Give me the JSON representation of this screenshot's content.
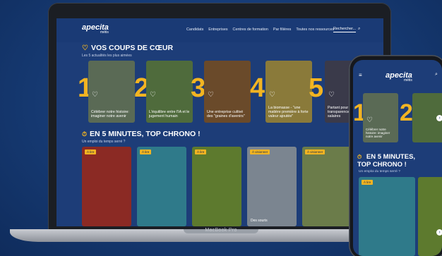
{
  "device_label": "MacBook Pro",
  "site": {
    "logo": "apecita",
    "logo_sub": "métis",
    "nav": [
      "Candidats",
      "Entreprises",
      "Centres de formation",
      "Par filières",
      "Toutes nos ressources"
    ],
    "search_label": "Rechercher..."
  },
  "favorites": {
    "title": "VOS COUPS DE CŒUR",
    "subtitle": "Les 5 actualités les plus aimées",
    "cards": [
      {
        "rank": "1",
        "text": "Célébrer notre histoire: imaginer notre avenir",
        "color": "#5a6a55"
      },
      {
        "rank": "2",
        "text": "L'équilibre entre l'IA et le jugement humain",
        "color": "#4f6b3c"
      },
      {
        "rank": "3",
        "text": "Une entreprise cultivé des \"graines d'avenirs\"",
        "color": "#6a4a2a"
      },
      {
        "rank": "4",
        "text": "La biomasse - \"une matière première à forte valeur ajoutée\"",
        "color": "#8a7a3a"
      },
      {
        "rank": "5",
        "text": "Partant pour la transparence des salaires",
        "color": "#3a3a4a"
      }
    ]
  },
  "five_minutes": {
    "title": "EN 5 MINUTES, TOP CHRONO !",
    "subtitle": "Un emploi du temps serré ?",
    "tiles": [
      {
        "badge": "À lire",
        "caption": "",
        "color": "#8b2a24"
      },
      {
        "badge": "À lire",
        "caption": "",
        "color": "#2f7a8a"
      },
      {
        "badge": "À lire",
        "caption": "",
        "color": "#5d7a2e"
      },
      {
        "badge": "À visionner",
        "caption": "Des souris",
        "color": "#7b8590"
      },
      {
        "badge": "À visionner",
        "caption": "",
        "color": "#6b7c4a"
      }
    ]
  },
  "phone": {
    "logo": "apecita",
    "logo_sub": "métis",
    "section_title_line1": "EN 5 MINUTES,",
    "section_title_line2": "TOP CHRONO !",
    "section_subtitle": "Un emploi du temps serré ?",
    "card1_text": "Célébrer notre histoire: imaginer notre avenir",
    "tile_badge": "À lire",
    "ranks": [
      "1",
      "2"
    ]
  }
}
